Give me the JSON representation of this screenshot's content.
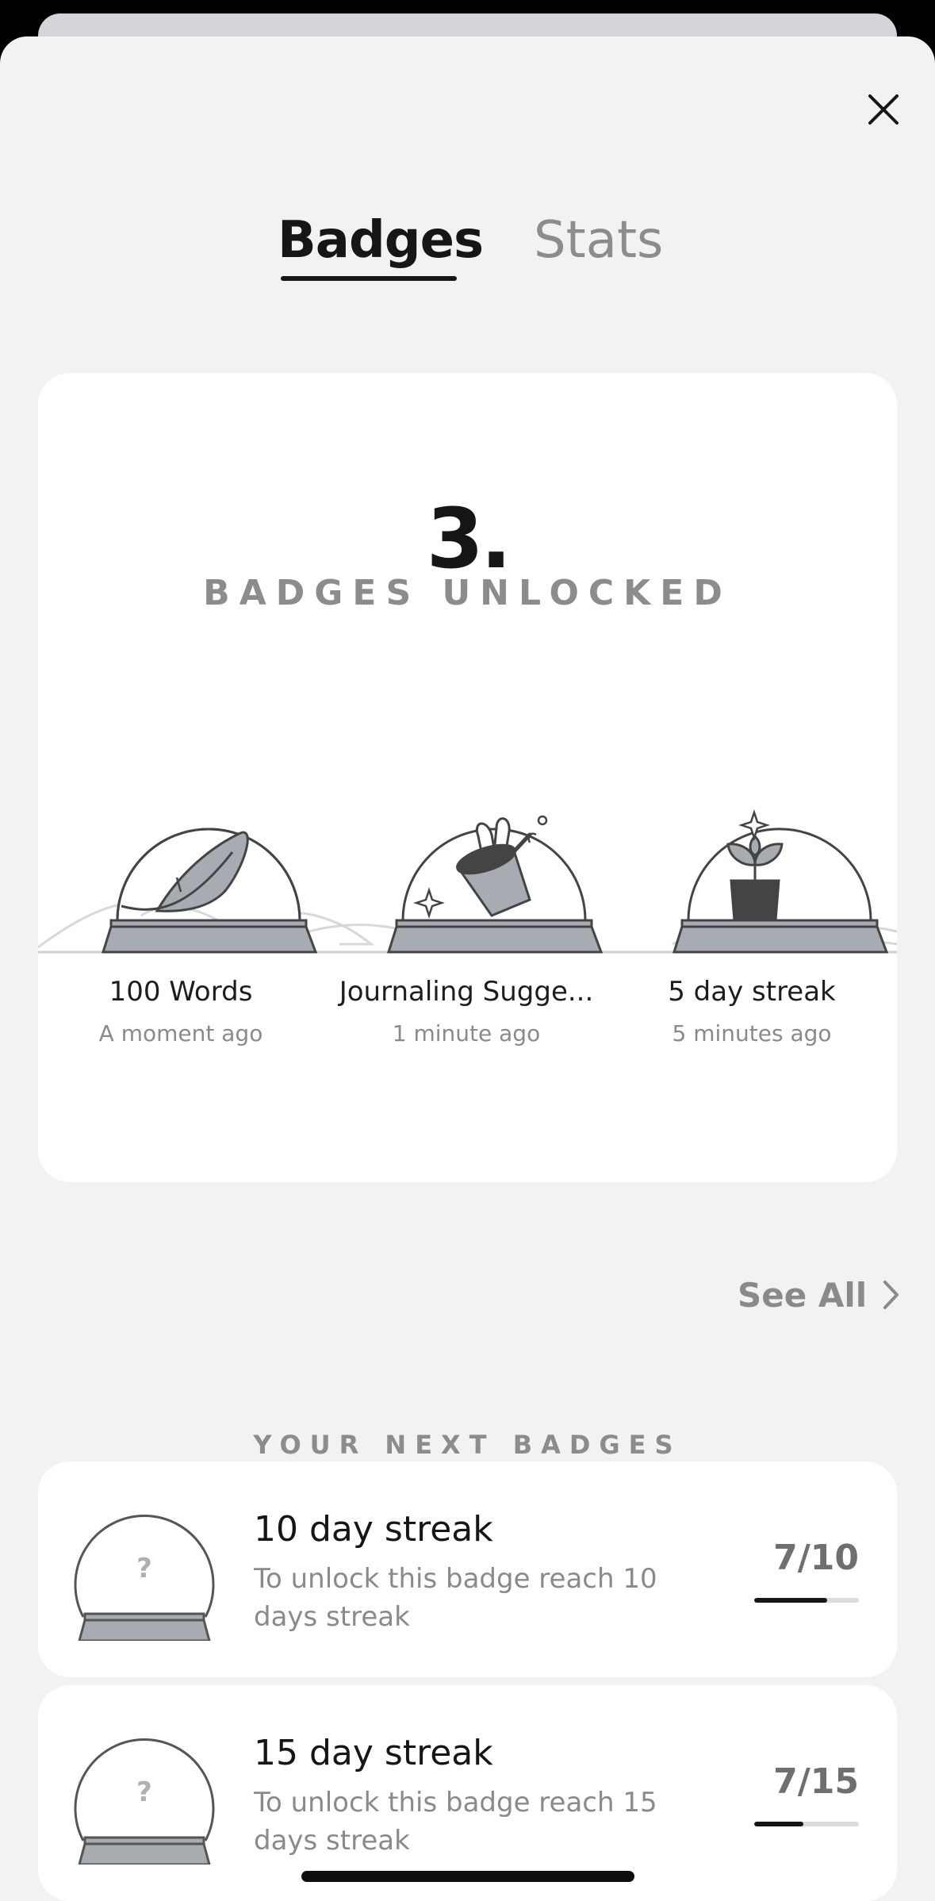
{
  "tabs": {
    "badges": "Badges",
    "stats": "Stats",
    "active": "Badges"
  },
  "summary": {
    "count": "3.",
    "label": "BADGES UNLOCKED",
    "badges": [
      {
        "title": "100 Words",
        "time": "A moment ago",
        "icon": "feather-icon"
      },
      {
        "title": "Journaling Sugge...",
        "time": "1 minute ago",
        "icon": "magic-hat-icon"
      },
      {
        "title": "5 day streak",
        "time": "5 minutes ago",
        "icon": "plant-icon"
      }
    ]
  },
  "see_all": {
    "label": "See All"
  },
  "next": {
    "label": "YOUR NEXT BADGES",
    "items": [
      {
        "title": "10 day streak",
        "description": "To unlock this badge reach 10 days streak",
        "progress_text": "7/10",
        "progress": 0.7
      },
      {
        "title": "15 day streak",
        "description": "To unlock this badge reach 15 days streak",
        "progress_text": "7/15",
        "progress": 0.4667
      }
    ],
    "locked_symbol": "?"
  },
  "colors": {
    "background": "#f1f2f4",
    "card": "#ffffff",
    "text": "#161616",
    "muted": "#8c8c8c",
    "base": "#a7acb3"
  }
}
